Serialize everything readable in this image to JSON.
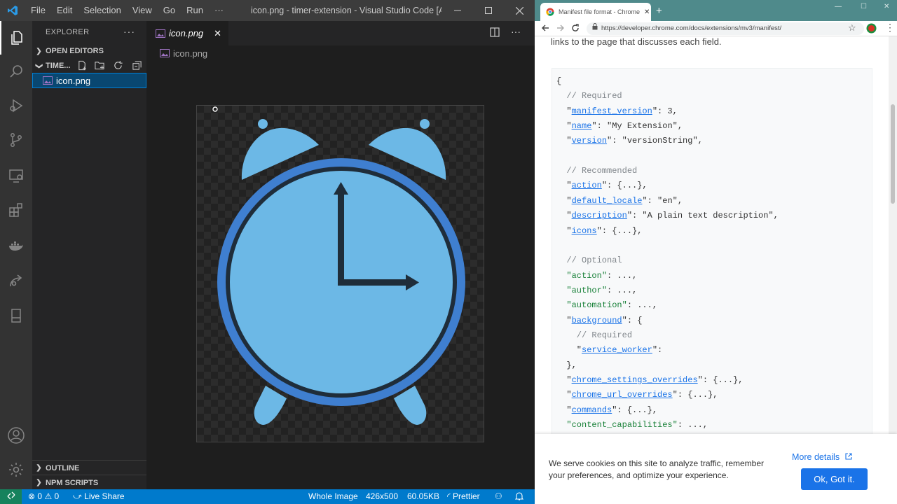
{
  "vscode": {
    "menu": [
      "File",
      "Edit",
      "Selection",
      "View",
      "Go",
      "Run",
      "···"
    ],
    "window_title": "icon.png - timer-extension - Visual Studio Code [Ad...",
    "sidebar": {
      "header": "EXPLORER",
      "more": "···",
      "open_editors": "OPEN EDITORS",
      "folder": "TIME...",
      "file": "icon.png",
      "outline": "OUTLINE",
      "npm_scripts": "NPM SCRIPTS"
    },
    "tab": {
      "label": "icon.png",
      "close": "✕"
    },
    "breadcrumb": "icon.png",
    "status": {
      "errors": "0",
      "warnings": "0",
      "live_share": "Live Share",
      "whole_image": "Whole Image",
      "dimensions": "426x500",
      "size": "60.05KB",
      "prettier": "Prettier"
    },
    "colors": {
      "accent": "#007acc",
      "clock_light": "#6cb8e6",
      "clock_ring": "#3f7fd0",
      "clock_hands": "#1f2d3a"
    }
  },
  "chrome": {
    "tab_title": "Manifest file format - Chrome De",
    "url": "https://developer.chrome.com/docs/extensions/mv3/manifest/",
    "intro": "links to the page that discusses each field.",
    "code_lines": [
      {
        "parts": [
          [
            "p",
            "{"
          ]
        ]
      },
      {
        "parts": [
          [
            "c",
            "  // Required"
          ]
        ]
      },
      {
        "parts": [
          [
            "p",
            "  \""
          ],
          [
            "k",
            "manifest_version"
          ],
          [
            "p",
            "\": 3,"
          ]
        ]
      },
      {
        "parts": [
          [
            "p",
            "  \""
          ],
          [
            "k",
            "name"
          ],
          [
            "p",
            "\": \"My Extension\","
          ]
        ]
      },
      {
        "parts": [
          [
            "p",
            "  \""
          ],
          [
            "k",
            "version"
          ],
          [
            "p",
            "\": \"versionString\","
          ]
        ]
      },
      {
        "parts": []
      },
      {
        "parts": [
          [
            "c",
            "  // Recommended"
          ]
        ]
      },
      {
        "parts": [
          [
            "p",
            "  \""
          ],
          [
            "k",
            "action"
          ],
          [
            "p",
            "\": {...},"
          ]
        ]
      },
      {
        "parts": [
          [
            "p",
            "  \""
          ],
          [
            "k",
            "default_locale"
          ],
          [
            "p",
            "\": \"en\","
          ]
        ]
      },
      {
        "parts": [
          [
            "p",
            "  \""
          ],
          [
            "k",
            "description"
          ],
          [
            "p",
            "\": \"A plain text description\","
          ]
        ]
      },
      {
        "parts": [
          [
            "p",
            "  \""
          ],
          [
            "k",
            "icons"
          ],
          [
            "p",
            "\": {...},"
          ]
        ]
      },
      {
        "parts": []
      },
      {
        "parts": [
          [
            "c",
            "  // Optional"
          ]
        ]
      },
      {
        "parts": [
          [
            "p",
            "  "
          ],
          [
            "s",
            "\"action\""
          ],
          [
            "p",
            ": ...,"
          ]
        ]
      },
      {
        "parts": [
          [
            "p",
            "  "
          ],
          [
            "s",
            "\"author\""
          ],
          [
            "p",
            ": ...,"
          ]
        ]
      },
      {
        "parts": [
          [
            "p",
            "  "
          ],
          [
            "s",
            "\"automation\""
          ],
          [
            "p",
            ": ...,"
          ]
        ]
      },
      {
        "parts": [
          [
            "p",
            "  \""
          ],
          [
            "k",
            "background"
          ],
          [
            "p",
            "\": {"
          ]
        ]
      },
      {
        "parts": [
          [
            "c",
            "    // Required"
          ]
        ]
      },
      {
        "parts": [
          [
            "p",
            "    \""
          ],
          [
            "k",
            "service_worker"
          ],
          [
            "p",
            "\":"
          ]
        ]
      },
      {
        "parts": [
          [
            "p",
            "  },"
          ]
        ]
      },
      {
        "parts": [
          [
            "p",
            "  \""
          ],
          [
            "k",
            "chrome_settings_overrides"
          ],
          [
            "p",
            "\": {...},"
          ]
        ]
      },
      {
        "parts": [
          [
            "p",
            "  \""
          ],
          [
            "k",
            "chrome_url_overrides"
          ],
          [
            "p",
            "\": {...},"
          ]
        ]
      },
      {
        "parts": [
          [
            "p",
            "  \""
          ],
          [
            "k",
            "commands"
          ],
          [
            "p",
            "\": {...},"
          ]
        ]
      },
      {
        "parts": [
          [
            "p",
            "  "
          ],
          [
            "s",
            "\"content_capabilities\""
          ],
          [
            "p",
            ": ...,"
          ]
        ]
      }
    ],
    "cookie": {
      "text": "We serve cookies on this site to analyze traffic, remember your preferences, and optimize your experience.",
      "more_details": "More details",
      "ok": "Ok, Got it."
    }
  }
}
